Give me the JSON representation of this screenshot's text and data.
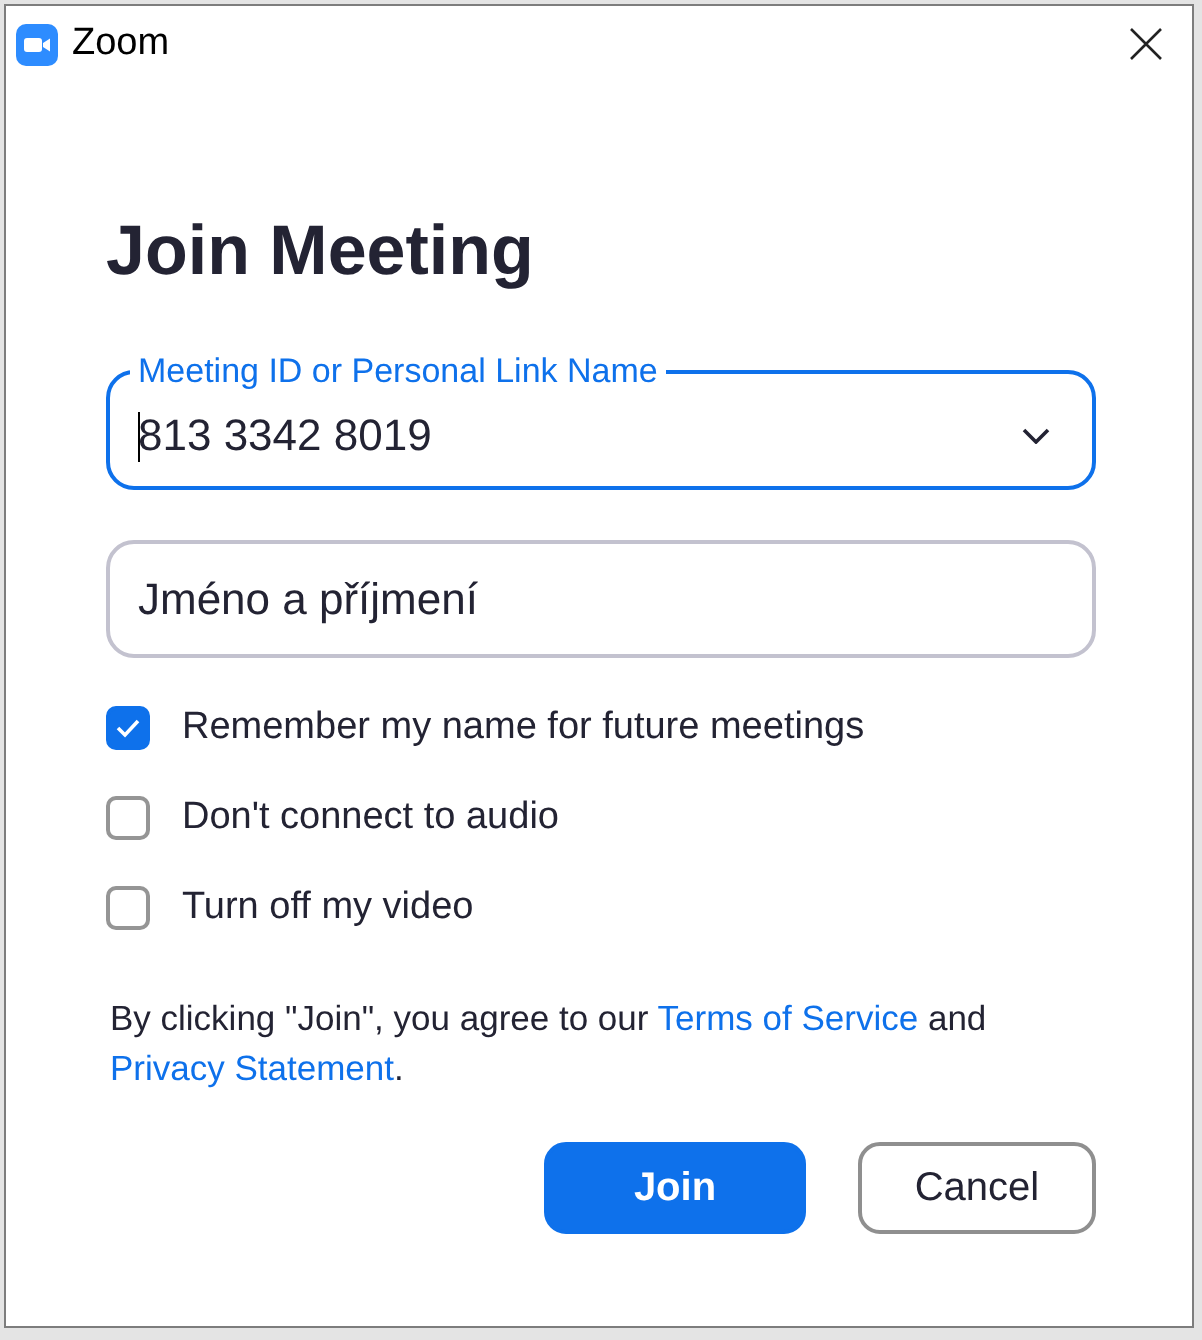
{
  "window": {
    "title": "Zoom"
  },
  "heading": "Join Meeting",
  "meeting_id_field": {
    "label": "Meeting ID or Personal Link Name",
    "value": "813 3342 8019",
    "focused": true
  },
  "name_field": {
    "value": "Jméno a příjmení",
    "focused": false
  },
  "options": [
    {
      "label": "Remember my name for future meetings",
      "checked": true
    },
    {
      "label": "Don't connect to audio",
      "checked": false
    },
    {
      "label": "Turn off my video",
      "checked": false
    }
  ],
  "terms_notice": [
    {
      "kind": "text",
      "text": "By clicking \"Join\", you agree to our "
    },
    {
      "kind": "link",
      "text": "Terms of Service"
    },
    {
      "kind": "text",
      "text": " and "
    },
    {
      "kind": "link",
      "text": "Privacy Statement"
    },
    {
      "kind": "text",
      "text": "."
    }
  ],
  "buttons": [
    {
      "label": "Join",
      "kind": "primary"
    },
    {
      "label": "Cancel",
      "kind": "secondary"
    }
  ]
}
